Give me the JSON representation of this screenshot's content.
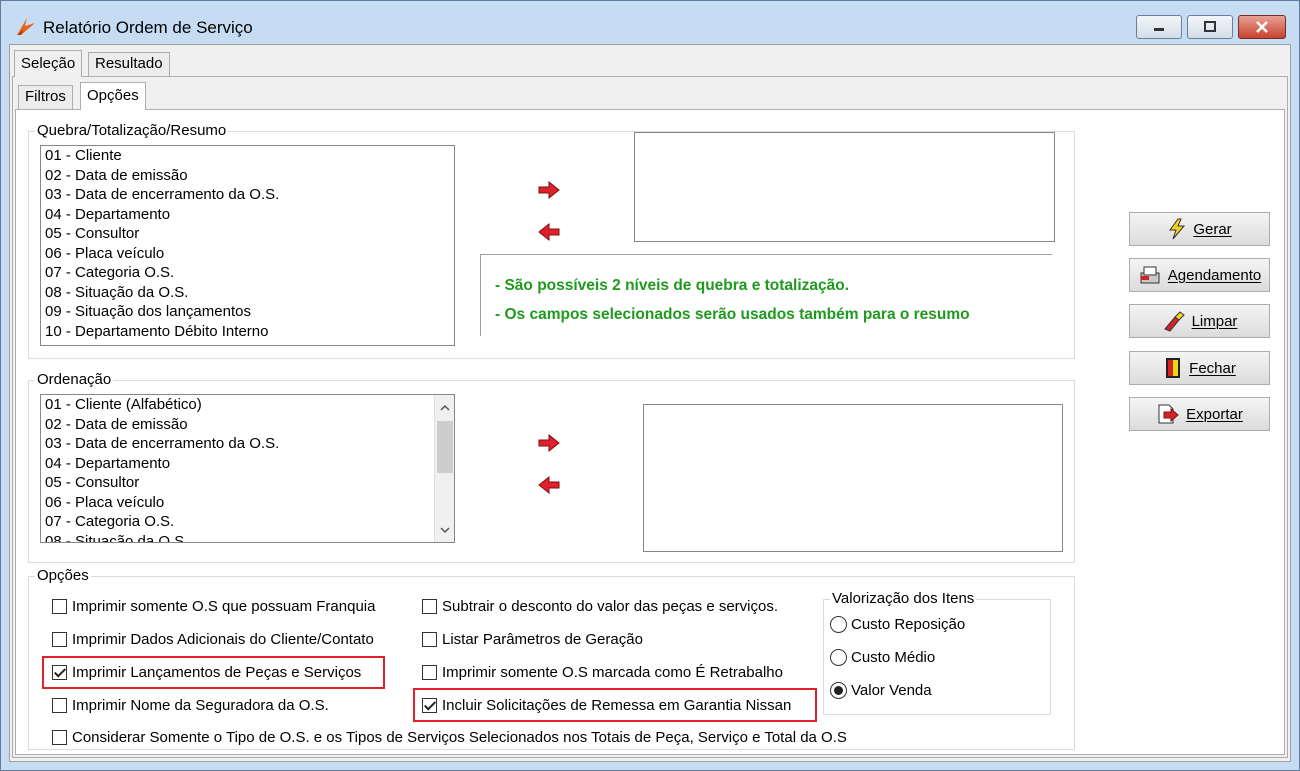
{
  "window": {
    "title": "Relatório Ordem de Serviço"
  },
  "outer_tabs": [
    {
      "label": "Seleção"
    },
    {
      "label": "Resultado"
    }
  ],
  "inner_tabs": [
    {
      "label": "Filtros"
    },
    {
      "label": "Opções"
    }
  ],
  "quebra": {
    "label": "Quebra/Totalização/Resumo",
    "items": [
      "01 - Cliente",
      "02 - Data de emissão",
      "03 - Data de encerramento da O.S.",
      "04 - Departamento",
      "05 - Consultor",
      "06 - Placa veículo",
      "07 - Categoria O.S.",
      "08 - Situação da O.S.",
      "09 - Situação dos lançamentos",
      "10 - Departamento Débito Interno"
    ],
    "notes": [
      "- São possíveis 2 níveis de quebra e totalização.",
      "- Os campos selecionados serão usados também para o resumo"
    ]
  },
  "ordenacao": {
    "label": "Ordenação",
    "items": [
      "01 - Cliente (Alfabético)",
      "02 - Data de emissão",
      "03 - Data de encerramento da O.S.",
      "04 - Departamento",
      "05 - Consultor",
      "06 - Placa veículo",
      "07 - Categoria O.S.",
      "08 - Situação da O.S."
    ]
  },
  "opcoes": {
    "label": "Opções",
    "checkboxes": {
      "franquia": {
        "label": "Imprimir somente O.S que possuam Franquia",
        "checked": false
      },
      "dados_adicionais": {
        "label": "Imprimir  Dados Adicionais do Cliente/Contato",
        "checked": false
      },
      "lancamentos": {
        "label": "Imprimir Lançamentos de Peças e Serviços",
        "checked": true
      },
      "seguradora": {
        "label": "Imprimir Nome da Seguradora da O.S.",
        "checked": false
      },
      "subtrair_desconto": {
        "label": "Subtrair o desconto do valor das peças e serviços.",
        "checked": false
      },
      "listar_parametros": {
        "label": "Listar Parâmetros de Geração",
        "checked": false
      },
      "retrabalho": {
        "label": "Imprimir somente O.S marcada como É Retrabalho",
        "checked": false
      },
      "garantia_nissan": {
        "label": "Incluir Solicitações de Remessa em Garantia Nissan",
        "checked": true
      },
      "considerar_tipo": {
        "label": "Considerar Somente o Tipo de O.S. e os Tipos de Serviços Selecionados nos Totais de Peça, Serviço e Total da O.S",
        "checked": false
      }
    },
    "valorizacao": {
      "label": "Valorização dos Itens",
      "options": [
        {
          "label": "Custo Reposição",
          "selected": false
        },
        {
          "label": "Custo Médio",
          "selected": false
        },
        {
          "label": "Valor Venda",
          "selected": true
        }
      ]
    }
  },
  "buttons": {
    "gerar": "Gerar",
    "agendamento": "Agendamento",
    "limpar": "Limpar",
    "fechar": "Fechar",
    "exportar": "Exportar"
  },
  "colors": {
    "note_text": "#1e9a1e",
    "highlight": "#e0202a",
    "arrow_red": "#e0202a"
  }
}
